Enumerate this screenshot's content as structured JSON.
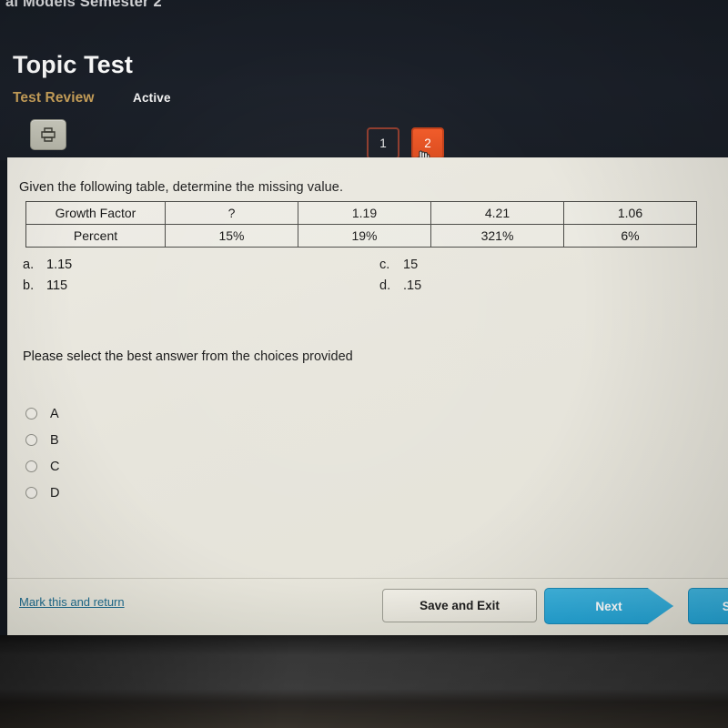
{
  "header": {
    "breadcrumb": "al Models Semester 2",
    "title": "Topic Test",
    "subtitle": "Test Review",
    "status": "Active",
    "print_icon": "printer-icon",
    "accent_gold": "#c9a15a",
    "background": "#1a1f27"
  },
  "pager": {
    "pages": [
      {
        "label": "1",
        "active": false
      },
      {
        "label": "2",
        "active": true
      }
    ],
    "active_color": "#f05a28",
    "cursor": "hand-cursor"
  },
  "question": {
    "prompt": "Given the following table, determine the missing value.",
    "table": {
      "rows": [
        {
          "label": "Growth Factor",
          "cells": [
            "?",
            "1.19",
            "4.21",
            "1.06"
          ]
        },
        {
          "label": "Percent",
          "cells": [
            "15%",
            "19%",
            "321%",
            "6%"
          ]
        }
      ]
    },
    "choices": [
      {
        "key": "a.",
        "value": "1.15"
      },
      {
        "key": "b.",
        "value": "115"
      },
      {
        "key": "c.",
        "value": "15"
      },
      {
        "key": "d.",
        "value": ".15"
      }
    ],
    "instruction": "Please select the best answer from the choices provided",
    "radio_options": [
      {
        "label": "A",
        "selected": false
      },
      {
        "label": "B",
        "selected": false
      },
      {
        "label": "C",
        "selected": false
      },
      {
        "label": "D",
        "selected": false
      }
    ]
  },
  "footer": {
    "mark_link": "Mark this and return",
    "save_exit_label": "Save and Exit",
    "next_label": "Next",
    "submit_label": "Sa",
    "link_color": "#1e6a8c",
    "button_color": "#23a2d3"
  }
}
